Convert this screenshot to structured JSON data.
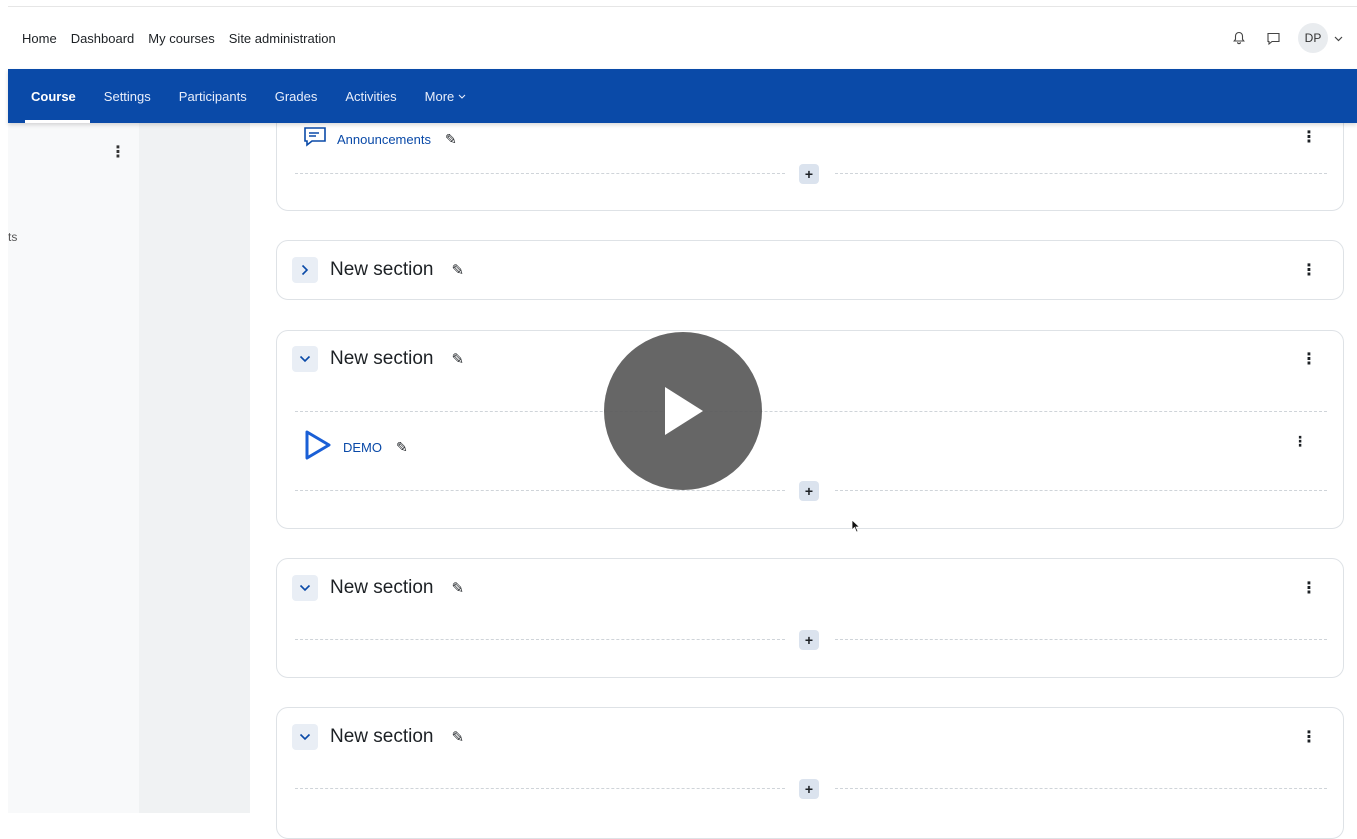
{
  "topbar": {
    "nav": [
      "Home",
      "Dashboard",
      "My courses",
      "Site administration"
    ],
    "user_initials": "DP",
    "icons": [
      "bell-icon",
      "chat-icon",
      "chevron-down-icon"
    ]
  },
  "coursenav": {
    "tabs": [
      "Course",
      "Settings",
      "Participants",
      "Grades",
      "Activities",
      "More"
    ],
    "active": "Course"
  },
  "drawer": {
    "fragment_text": "ts"
  },
  "sections": [
    {
      "activity": "Announcements",
      "icon": "forum-icon"
    },
    {
      "title": "New section",
      "collapsed": true
    },
    {
      "title": "New section",
      "collapsed": false,
      "activity": "DEMO",
      "icon": "video-play-icon"
    },
    {
      "title": "New section",
      "collapsed": false
    },
    {
      "title": "New section",
      "collapsed": false
    }
  ],
  "overlay": {
    "icon": "play-icon"
  },
  "colors": {
    "brand": "#0a4aa8",
    "background": "#ffffff"
  }
}
